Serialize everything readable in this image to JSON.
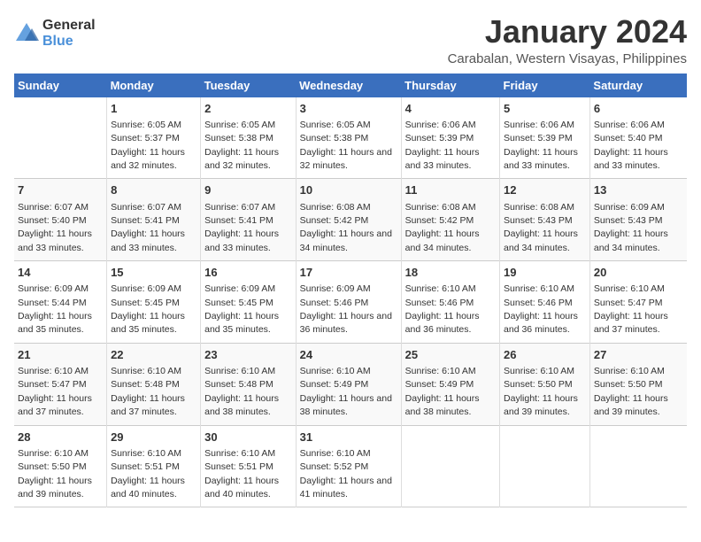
{
  "logo": {
    "general": "General",
    "blue": "Blue"
  },
  "title": "January 2024",
  "subtitle": "Carabalan, Western Visayas, Philippines",
  "days_header": [
    "Sunday",
    "Monday",
    "Tuesday",
    "Wednesday",
    "Thursday",
    "Friday",
    "Saturday"
  ],
  "weeks": [
    [
      {
        "num": "",
        "sunrise": "",
        "sunset": "",
        "daylight": ""
      },
      {
        "num": "1",
        "sunrise": "Sunrise: 6:05 AM",
        "sunset": "Sunset: 5:37 PM",
        "daylight": "Daylight: 11 hours and 32 minutes."
      },
      {
        "num": "2",
        "sunrise": "Sunrise: 6:05 AM",
        "sunset": "Sunset: 5:38 PM",
        "daylight": "Daylight: 11 hours and 32 minutes."
      },
      {
        "num": "3",
        "sunrise": "Sunrise: 6:05 AM",
        "sunset": "Sunset: 5:38 PM",
        "daylight": "Daylight: 11 hours and 32 minutes."
      },
      {
        "num": "4",
        "sunrise": "Sunrise: 6:06 AM",
        "sunset": "Sunset: 5:39 PM",
        "daylight": "Daylight: 11 hours and 33 minutes."
      },
      {
        "num": "5",
        "sunrise": "Sunrise: 6:06 AM",
        "sunset": "Sunset: 5:39 PM",
        "daylight": "Daylight: 11 hours and 33 minutes."
      },
      {
        "num": "6",
        "sunrise": "Sunrise: 6:06 AM",
        "sunset": "Sunset: 5:40 PM",
        "daylight": "Daylight: 11 hours and 33 minutes."
      }
    ],
    [
      {
        "num": "7",
        "sunrise": "Sunrise: 6:07 AM",
        "sunset": "Sunset: 5:40 PM",
        "daylight": "Daylight: 11 hours and 33 minutes."
      },
      {
        "num": "8",
        "sunrise": "Sunrise: 6:07 AM",
        "sunset": "Sunset: 5:41 PM",
        "daylight": "Daylight: 11 hours and 33 minutes."
      },
      {
        "num": "9",
        "sunrise": "Sunrise: 6:07 AM",
        "sunset": "Sunset: 5:41 PM",
        "daylight": "Daylight: 11 hours and 33 minutes."
      },
      {
        "num": "10",
        "sunrise": "Sunrise: 6:08 AM",
        "sunset": "Sunset: 5:42 PM",
        "daylight": "Daylight: 11 hours and 34 minutes."
      },
      {
        "num": "11",
        "sunrise": "Sunrise: 6:08 AM",
        "sunset": "Sunset: 5:42 PM",
        "daylight": "Daylight: 11 hours and 34 minutes."
      },
      {
        "num": "12",
        "sunrise": "Sunrise: 6:08 AM",
        "sunset": "Sunset: 5:43 PM",
        "daylight": "Daylight: 11 hours and 34 minutes."
      },
      {
        "num": "13",
        "sunrise": "Sunrise: 6:09 AM",
        "sunset": "Sunset: 5:43 PM",
        "daylight": "Daylight: 11 hours and 34 minutes."
      }
    ],
    [
      {
        "num": "14",
        "sunrise": "Sunrise: 6:09 AM",
        "sunset": "Sunset: 5:44 PM",
        "daylight": "Daylight: 11 hours and 35 minutes."
      },
      {
        "num": "15",
        "sunrise": "Sunrise: 6:09 AM",
        "sunset": "Sunset: 5:45 PM",
        "daylight": "Daylight: 11 hours and 35 minutes."
      },
      {
        "num": "16",
        "sunrise": "Sunrise: 6:09 AM",
        "sunset": "Sunset: 5:45 PM",
        "daylight": "Daylight: 11 hours and 35 minutes."
      },
      {
        "num": "17",
        "sunrise": "Sunrise: 6:09 AM",
        "sunset": "Sunset: 5:46 PM",
        "daylight": "Daylight: 11 hours and 36 minutes."
      },
      {
        "num": "18",
        "sunrise": "Sunrise: 6:10 AM",
        "sunset": "Sunset: 5:46 PM",
        "daylight": "Daylight: 11 hours and 36 minutes."
      },
      {
        "num": "19",
        "sunrise": "Sunrise: 6:10 AM",
        "sunset": "Sunset: 5:46 PM",
        "daylight": "Daylight: 11 hours and 36 minutes."
      },
      {
        "num": "20",
        "sunrise": "Sunrise: 6:10 AM",
        "sunset": "Sunset: 5:47 PM",
        "daylight": "Daylight: 11 hours and 37 minutes."
      }
    ],
    [
      {
        "num": "21",
        "sunrise": "Sunrise: 6:10 AM",
        "sunset": "Sunset: 5:47 PM",
        "daylight": "Daylight: 11 hours and 37 minutes."
      },
      {
        "num": "22",
        "sunrise": "Sunrise: 6:10 AM",
        "sunset": "Sunset: 5:48 PM",
        "daylight": "Daylight: 11 hours and 37 minutes."
      },
      {
        "num": "23",
        "sunrise": "Sunrise: 6:10 AM",
        "sunset": "Sunset: 5:48 PM",
        "daylight": "Daylight: 11 hours and 38 minutes."
      },
      {
        "num": "24",
        "sunrise": "Sunrise: 6:10 AM",
        "sunset": "Sunset: 5:49 PM",
        "daylight": "Daylight: 11 hours and 38 minutes."
      },
      {
        "num": "25",
        "sunrise": "Sunrise: 6:10 AM",
        "sunset": "Sunset: 5:49 PM",
        "daylight": "Daylight: 11 hours and 38 minutes."
      },
      {
        "num": "26",
        "sunrise": "Sunrise: 6:10 AM",
        "sunset": "Sunset: 5:50 PM",
        "daylight": "Daylight: 11 hours and 39 minutes."
      },
      {
        "num": "27",
        "sunrise": "Sunrise: 6:10 AM",
        "sunset": "Sunset: 5:50 PM",
        "daylight": "Daylight: 11 hours and 39 minutes."
      }
    ],
    [
      {
        "num": "28",
        "sunrise": "Sunrise: 6:10 AM",
        "sunset": "Sunset: 5:50 PM",
        "daylight": "Daylight: 11 hours and 39 minutes."
      },
      {
        "num": "29",
        "sunrise": "Sunrise: 6:10 AM",
        "sunset": "Sunset: 5:51 PM",
        "daylight": "Daylight: 11 hours and 40 minutes."
      },
      {
        "num": "30",
        "sunrise": "Sunrise: 6:10 AM",
        "sunset": "Sunset: 5:51 PM",
        "daylight": "Daylight: 11 hours and 40 minutes."
      },
      {
        "num": "31",
        "sunrise": "Sunrise: 6:10 AM",
        "sunset": "Sunset: 5:52 PM",
        "daylight": "Daylight: 11 hours and 41 minutes."
      },
      {
        "num": "",
        "sunrise": "",
        "sunset": "",
        "daylight": ""
      },
      {
        "num": "",
        "sunrise": "",
        "sunset": "",
        "daylight": ""
      },
      {
        "num": "",
        "sunrise": "",
        "sunset": "",
        "daylight": ""
      }
    ]
  ]
}
